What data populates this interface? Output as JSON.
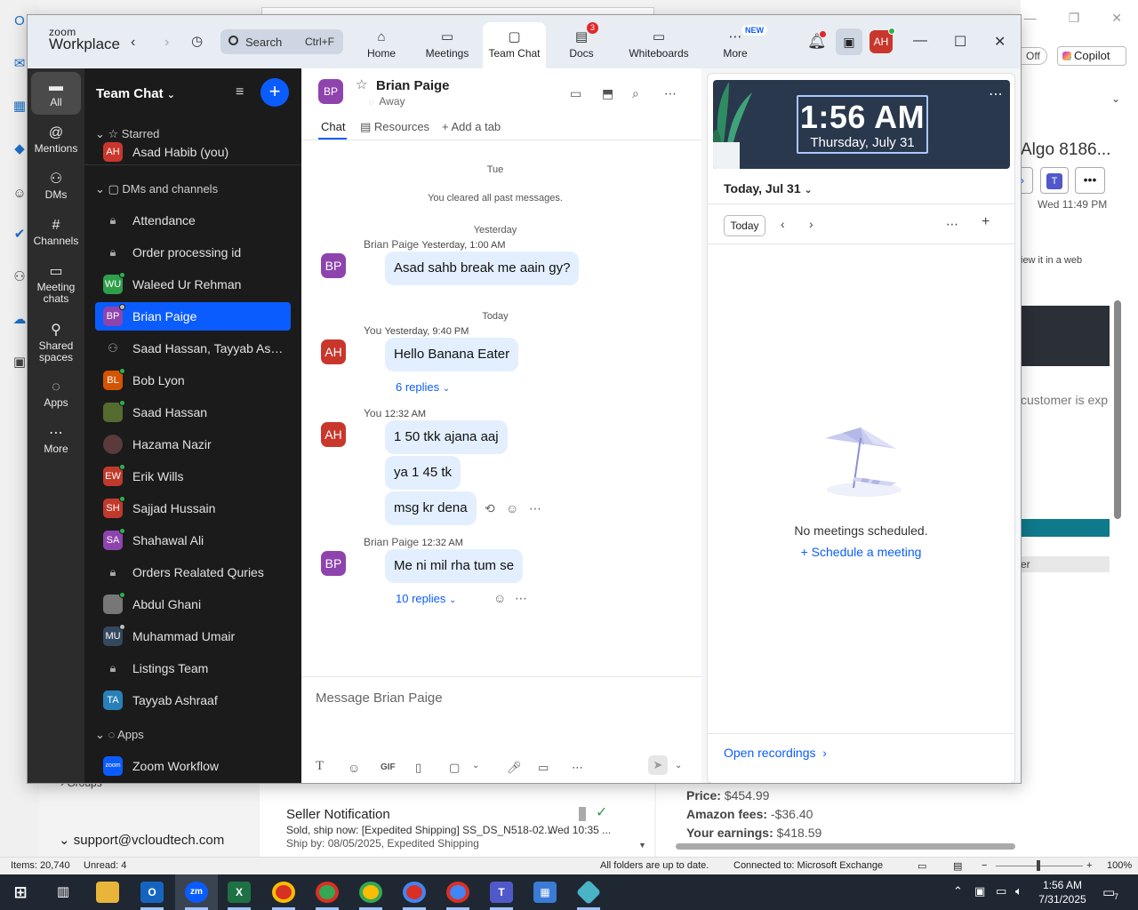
{
  "outlook": {
    "copilot_label": "Copilot",
    "off_label": "Off",
    "subject": "Algo 8186...",
    "date": "Wed 11:49 PM",
    "view_web": "iew it in a web",
    "customer_text": "customer is exp",
    "greybar_text": "er",
    "groups_label": "Groups",
    "account": "support@vcloudtech.com",
    "message": {
      "sender": "Seller Notification",
      "subject": "Sold, ship now: [Expedited Shipping] SS_DS_N518-02...",
      "time": "Wed 10:35 ...",
      "preview": "Ship by: 08/05/2025, Expedited Shipping"
    },
    "price_label": "Price:",
    "price_value": "$454.99",
    "fees_label": "Amazon fees:",
    "fees_value": "-$36.40",
    "earn_label": "Your earnings:",
    "earn_value": "$418.59",
    "status": {
      "items": "Items: 20,740",
      "unread": "Unread: 4",
      "sync": "All folders are up to date.",
      "connected": "Connected to: Microsoft Exchange",
      "zoom": "100%"
    }
  },
  "zoom": {
    "logo_top": "zoom",
    "logo_bottom": "Workplace",
    "search": {
      "label": "Search",
      "shortcut": "Ctrl+F"
    },
    "tabs": [
      {
        "label": "Home",
        "icon": "home-icon"
      },
      {
        "label": "Meetings",
        "icon": "video-icon"
      },
      {
        "label": "Team Chat",
        "icon": "chat-icon"
      },
      {
        "label": "Docs",
        "icon": "docs-icon",
        "badge": "3"
      },
      {
        "label": "Whiteboards",
        "icon": "whiteboard-icon"
      },
      {
        "label": "More",
        "icon": "more-icon",
        "tag": "NEW"
      }
    ],
    "avatar_initials": "AH",
    "rail": [
      {
        "label": "All"
      },
      {
        "label": "Mentions"
      },
      {
        "label": "DMs"
      },
      {
        "label": "Channels"
      },
      {
        "label": "Meeting chats"
      },
      {
        "label": "Shared spaces"
      },
      {
        "label": "Apps"
      },
      {
        "label": "More"
      }
    ],
    "list": {
      "title": "Team Chat",
      "starred_header": "Starred",
      "starred_item": {
        "initials": "AH",
        "label": "Asad Habib (you)"
      },
      "dms_header": "DMs and channels",
      "items": [
        {
          "initials": "",
          "label": "Attendance",
          "color": "#1b1b1b"
        },
        {
          "initials": "",
          "label": "Order processing id",
          "color": "#1b1b1b"
        },
        {
          "initials": "WU",
          "label": "Waleed Ur Rehman",
          "color": "#2e9e4a"
        },
        {
          "initials": "BP",
          "label": "Brian Paige",
          "color": "#8e44ad"
        },
        {
          "initials": "",
          "label": "Saad Hassan, Tayyab Ashra...",
          "color": "#1b1b1b"
        },
        {
          "initials": "BL",
          "label": "Bob Lyon",
          "color": "#d35400"
        },
        {
          "initials": "",
          "label": "Saad Hassan",
          "color": "#556b2f"
        },
        {
          "initials": "",
          "label": "Hazama Nazir",
          "color": "#5a3a3a"
        },
        {
          "initials": "EW",
          "label": "Erik Wills",
          "color": "#c0392b"
        },
        {
          "initials": "SH",
          "label": "Sajjad Hussain",
          "color": "#c0392b"
        },
        {
          "initials": "SA",
          "label": "Shahawal Ali",
          "color": "#8e44ad"
        },
        {
          "initials": "",
          "label": "Orders Realated Quries",
          "color": "#1b1b1b"
        },
        {
          "initials": "",
          "label": "Abdul Ghani",
          "color": "#777777"
        },
        {
          "initials": "MU",
          "label": "Muhammad Umair",
          "color": "#34495e"
        },
        {
          "initials": "",
          "label": "Listings Team",
          "color": "#1b1b1b"
        },
        {
          "initials": "TA",
          "label": "Tayyab Ashraaf",
          "color": "#2980b9"
        }
      ],
      "apps_header": "Apps",
      "app_item": {
        "initials": "zoom",
        "label": "Zoom Workflow"
      }
    },
    "chat": {
      "contact_initials": "BP",
      "contact_name": "Brian Paige",
      "contact_status": "Away",
      "tabs": [
        "Chat",
        "Resources",
        "Add a tab"
      ],
      "sep_tue": "Tue",
      "cleared": "You cleared all past messages.",
      "sep_yesterday": "Yesterday",
      "sep_today": "Today",
      "messages": [
        {
          "sender": "Brian Paige",
          "time": "Yesterday, 1:00 AM",
          "initials": "BP",
          "text": "Asad sahb break me aain gy?"
        },
        {
          "sender": "You",
          "time": "Yesterday, 9:40 PM",
          "initials": "AH",
          "text": "Hello Banana Eater",
          "replies": "6 replies"
        },
        {
          "sender": "You",
          "time": "12:32 AM",
          "initials": "AH",
          "text": "1 50 tkk ajana aaj"
        },
        {
          "text": "ya 1 45 tk"
        },
        {
          "text": "msg kr dena"
        },
        {
          "sender": "Brian Paige",
          "time": "12:32 AM",
          "initials": "BP",
          "text": "Me ni mil rha tum se",
          "replies": "10 replies"
        }
      ],
      "composer_placeholder": "Message Brian Paige",
      "gif_label": "GIF"
    },
    "calendar": {
      "clock_time": "1:56 AM",
      "clock_date": "Thursday, July 31",
      "date_header": "Today, Jul 31",
      "today_btn": "Today",
      "empty": "No meetings scheduled.",
      "schedule": "Schedule a meeting",
      "recordings": "Open recordings"
    }
  },
  "taskbar": {
    "time": "1:56 AM",
    "date": "7/31/2025",
    "notifications": "7"
  }
}
